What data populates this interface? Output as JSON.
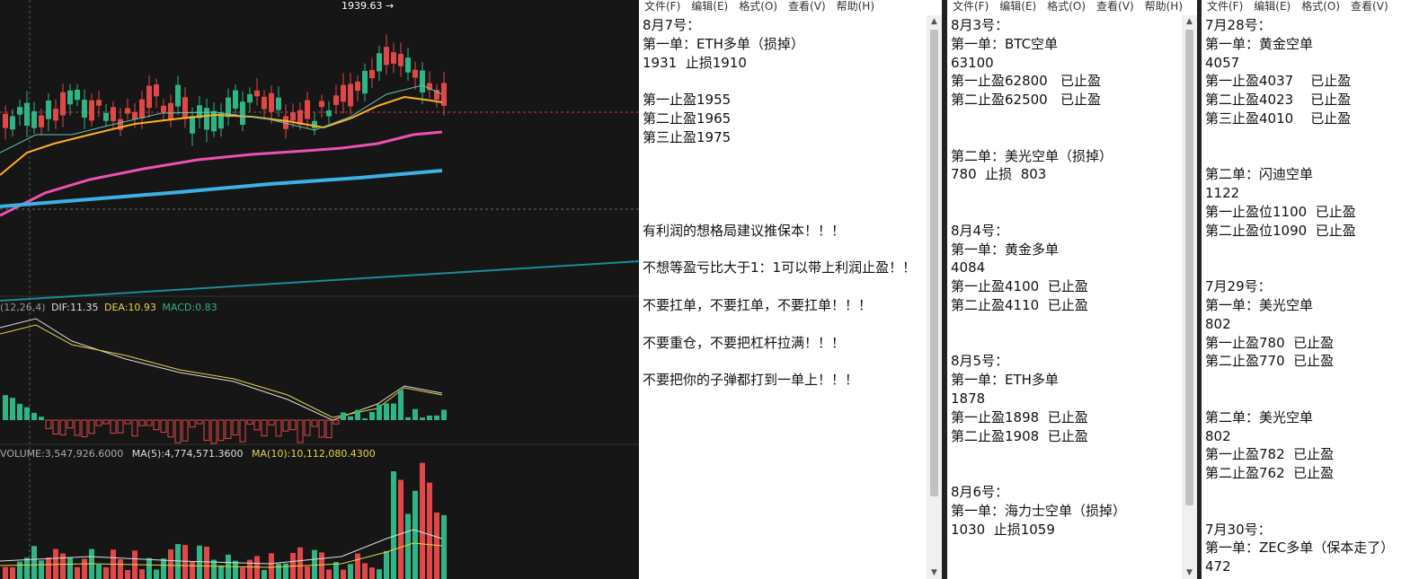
{
  "chart": {
    "price_marker": "1939.63",
    "macd": {
      "params": "(12,26,4)",
      "dif": "DIF:11.35",
      "dea": "DEA:10.93",
      "macd": "MACD:0.83"
    },
    "volume": {
      "vol": "VOLUME:3,547,926.6000",
      "ma5": "MA(5):4,774,571.3600",
      "ma10": "MA(10):10,112,080.4300"
    },
    "colors": {
      "up": "#2fb483",
      "down": "#e04848",
      "ma_short": "#ffb020",
      "ma_mid": "#f050b0",
      "ma_long": "#3cb0e8",
      "ma_longest": "#1a8c96",
      "dea": "#e6d44a"
    }
  },
  "menu_items": [
    "文件(F)",
    "编辑(E)",
    "格式(O)",
    "查看(V)",
    "帮助(H)"
  ],
  "notepads": [
    {
      "lines": [
        "8月7号：",
        "第一单：ETH多单（损掉）",
        "1931  止损1910",
        "",
        "第一止盈1955",
        "第二止盈1965",
        "第三止盈1975",
        "",
        "",
        "",
        "",
        "有利润的想格局建议推保本！！！",
        "",
        "不想等盈亏比大于1：1可以带上利润止盈！！",
        "",
        "不要扛单，不要扛单，不要扛单！！！",
        "",
        "不要重仓，不要把杠杆拉满！！！",
        "",
        "不要把你的子弹都打到一单上！！！"
      ]
    },
    {
      "lines": [
        "8月3号：",
        "第一单：BTC空单",
        "63100",
        "第一止盈62800   已止盈",
        "第二止盈62500   已止盈",
        "",
        "",
        "第二单：美光空单（损掉）",
        "780  止损  803",
        "",
        "",
        "8月4号：",
        "第一单：黄金多单",
        "4084",
        "第一止盈4100  已止盈",
        "第二止盈4110  已止盈",
        "",
        "",
        "8月5号：",
        "第一单：ETH多单",
        "1878",
        "第一止盈1898  已止盈",
        "第二止盈1908  已止盈",
        "",
        "",
        "8月6号：",
        "第一单：海力士空单（损掉）",
        "1030  止损1059"
      ]
    },
    {
      "lines": [
        "7月28号：",
        "第一单：黄金空单",
        "4057",
        "第一止盈4037    已止盈",
        "第二止盈4023    已止盈",
        "第三止盈4010    已止盈",
        "",
        "",
        "第二单：闪迪空单",
        "1122",
        "第一止盈位1100  已止盈",
        "第二止盈位1090  已止盈",
        "",
        "",
        "7月29号：",
        "第一单：美光空单",
        "802",
        "第一止盈780  已止盈",
        "第二止盈770  已止盈",
        "",
        "",
        "第二单：美光空单",
        "802",
        "第一止盈782  已止盈",
        "第二止盈762  已止盈",
        "",
        "",
        "7月30号：",
        "第一单：ZEC多单（保本走了）",
        "472"
      ]
    }
  ]
}
